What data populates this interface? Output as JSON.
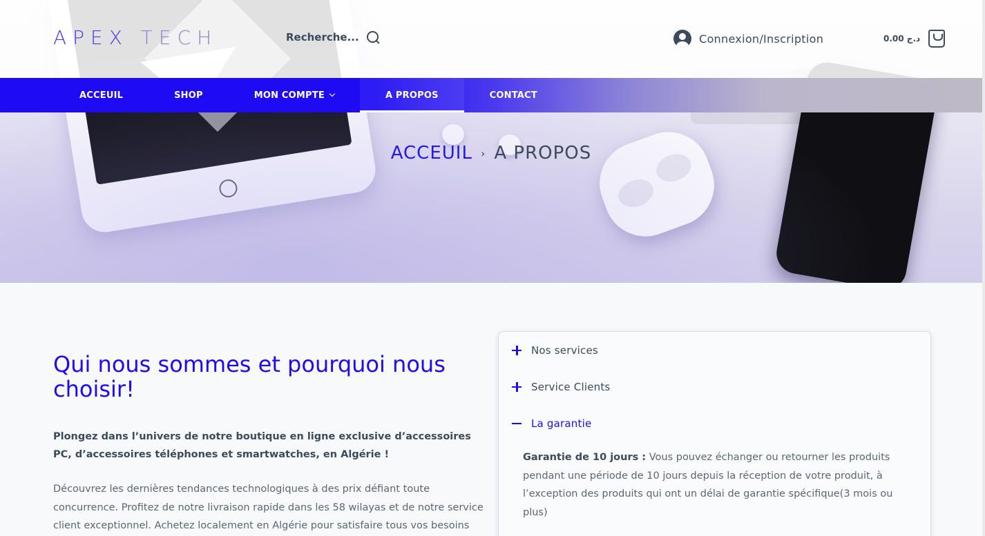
{
  "header": {
    "logo_main": "APEX",
    "logo_sub": "TECH",
    "search_label": "Recherche...",
    "account_label": "Connexion/Inscription",
    "cart_total": "0.00 د.ج"
  },
  "nav": {
    "items": [
      {
        "label": "ACCEUIL"
      },
      {
        "label": "SHOP"
      },
      {
        "label": "MON COMPTE"
      },
      {
        "label": "A PROPOS"
      },
      {
        "label": "CONTACT"
      }
    ]
  },
  "breadcrumb": {
    "home": "ACCEUIL",
    "separator": "›",
    "current": "A PROPOS"
  },
  "main": {
    "title": "Qui nous sommes et pourquoi nous choisir!",
    "intro_bold": "Plongez dans l’univers de notre boutique en ligne exclusive d’accessoires PC, d’accessoires téléphones et smartwatches, en Algérie !",
    "intro_body": "Découvrez les dernières tendances technologiques à des prix défiant toute concurrence. Profitez de notre livraison rapide dans les 58 wilayas et de notre service client exceptionnel. Achetez localement en Algérie pour satisfaire tous vos besoins"
  },
  "accordion": {
    "items": [
      {
        "label": "Nos services"
      },
      {
        "label": "Service Clients"
      },
      {
        "label": "La garantie"
      }
    ],
    "open_body_lead": "Garantie de 10 jours :",
    "open_body_text": " Vous pouvez échanger ou retourner les produits pendant une période de 10 jours depuis la réception de votre produit, à l’exception des produits qui ont un délai de garantie spécifique(3 mois ou plus)"
  },
  "colors": {
    "brand": "#1e0bf4",
    "text": "#3b4a5c"
  }
}
